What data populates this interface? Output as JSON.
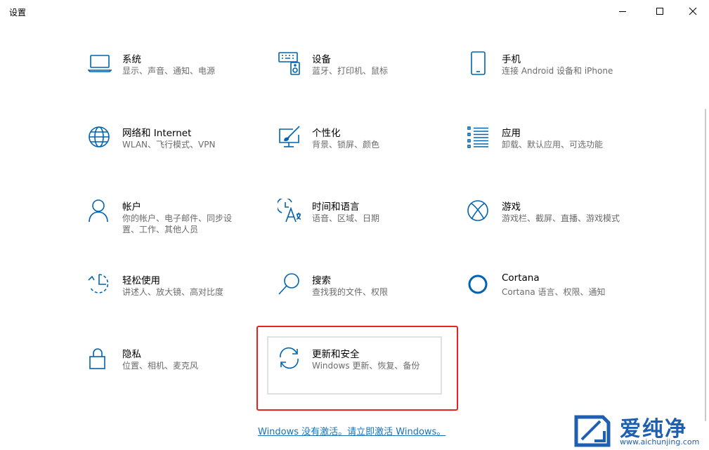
{
  "window": {
    "title": "设置"
  },
  "tiles": [
    {
      "title": "系统",
      "desc": "显示、声音、通知、电源"
    },
    {
      "title": "设备",
      "desc": "蓝牙、打印机、鼠标"
    },
    {
      "title": "手机",
      "desc": "连接 Android 设备和 iPhone"
    },
    {
      "title": "网络和 Internet",
      "desc": "WLAN、飞行模式、VPN"
    },
    {
      "title": "个性化",
      "desc": "背景、锁屏、颜色"
    },
    {
      "title": "应用",
      "desc": "卸载、默认应用、可选功能"
    },
    {
      "title": "帐户",
      "desc": "你的帐户、电子邮件、同步设置、工作、其他人员"
    },
    {
      "title": "时间和语言",
      "desc": "语音、区域、日期"
    },
    {
      "title": "游戏",
      "desc": "游戏栏、截屏、直播、游戏模式"
    },
    {
      "title": "轻松使用",
      "desc": "讲述人、放大镜、高对比度"
    },
    {
      "title": "搜索",
      "desc": "查找我的文件、权限"
    },
    {
      "title": "Cortana",
      "desc": "Cortana 语言、权限、通知"
    },
    {
      "title": "隐私",
      "desc": "位置、相机、麦克风"
    },
    {
      "title": "更新和安全",
      "desc": "Windows 更新、恢复、备份"
    }
  ],
  "activation_link": "Windows 没有激活。请立即激活 Windows。",
  "watermark": {
    "text": "爱纯净",
    "url": "www.aichunjing.com"
  },
  "colors": {
    "icon": "#0063b1",
    "highlight_border": "#e8231f",
    "link": "#1a73b8"
  }
}
